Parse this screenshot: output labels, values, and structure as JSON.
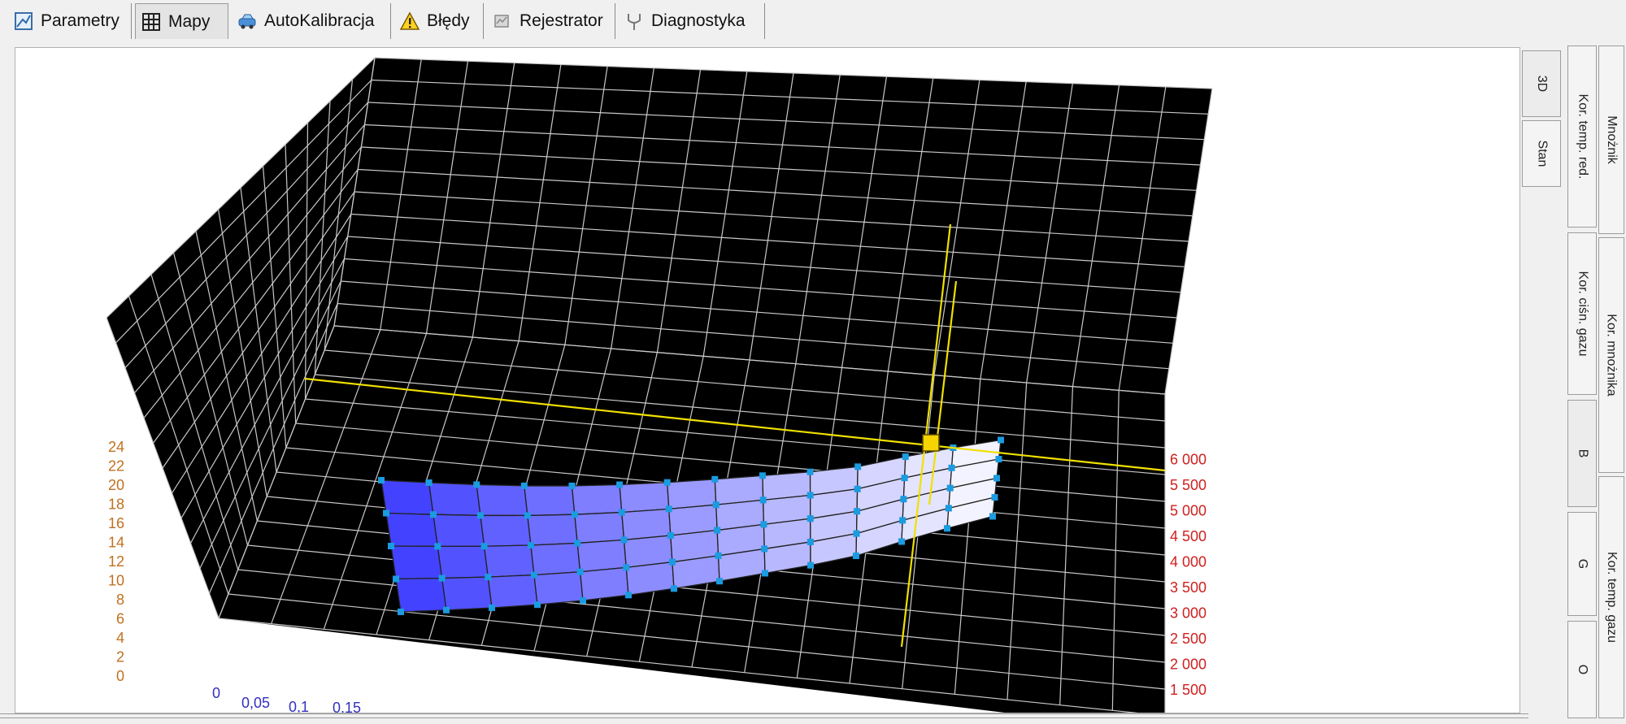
{
  "tabs": [
    {
      "label": "Parametry",
      "icon": "parameters-icon"
    },
    {
      "label": "Mapy",
      "icon": "grid-map-icon"
    },
    {
      "label": "AutoKalibracja",
      "icon": "car-calibration-icon"
    },
    {
      "label": "Błędy",
      "icon": "warning-icon"
    },
    {
      "label": "Rejestrator",
      "icon": "recorder-icon"
    },
    {
      "label": "Diagnostyka",
      "icon": "diagnostics-icon"
    }
  ],
  "active_tab": "Mapy",
  "view_tabs": [
    "3D",
    "Stan"
  ],
  "right_tabs_col1": [
    "Kor. temp. red.",
    "Kor. ciśn. gazu",
    "B",
    "G",
    "O"
  ],
  "right_tabs_col2": [
    "Mnożnik",
    "Kor. mnożnika",
    "Kor. temp. gazu"
  ],
  "plot": {
    "z_ticks": [
      "0",
      "2",
      "4",
      "6",
      "8",
      "10",
      "12",
      "14",
      "16",
      "18",
      "20",
      "22",
      "24"
    ],
    "rpm_ticks": [
      "1 500",
      "2 000",
      "2 500",
      "3 000",
      "3 500",
      "4 000",
      "4 500",
      "5 000",
      "5 500",
      "6 000"
    ],
    "x_ticks": [
      "0",
      "0,05",
      "0,1",
      "0,15"
    ],
    "colors": {
      "background": "#000000",
      "grid": "#c8c8c8",
      "cursor": "#f0e000",
      "z_labels": "#c07020",
      "rpm_labels": "#d02020",
      "x_labels": "#3030c0",
      "points": "#1b9be0"
    }
  }
}
